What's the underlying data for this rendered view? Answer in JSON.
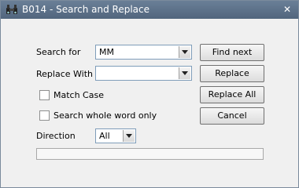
{
  "window": {
    "title": "B014 - Search and Replace",
    "close_glyph": "✕"
  },
  "search": {
    "label": "Search for",
    "value": "MM"
  },
  "replace": {
    "label": "Replace With",
    "value": ""
  },
  "options": {
    "match_case": {
      "label": "Match Case",
      "checked": false
    },
    "whole_word": {
      "label": "Search whole word only",
      "checked": false
    }
  },
  "direction": {
    "label": "Direction",
    "value": "All"
  },
  "buttons": {
    "find_next": "Find next",
    "replace": "Replace",
    "replace_all": "Replace All",
    "cancel": "Cancel"
  },
  "progress": {
    "value": 0
  },
  "icons": {
    "title": "binoculars-icon",
    "close": "close-icon",
    "dropdown": "chevron-down-icon"
  },
  "colors": {
    "titlebar": "#5c7089",
    "window_bg": "#f0f0f0"
  }
}
